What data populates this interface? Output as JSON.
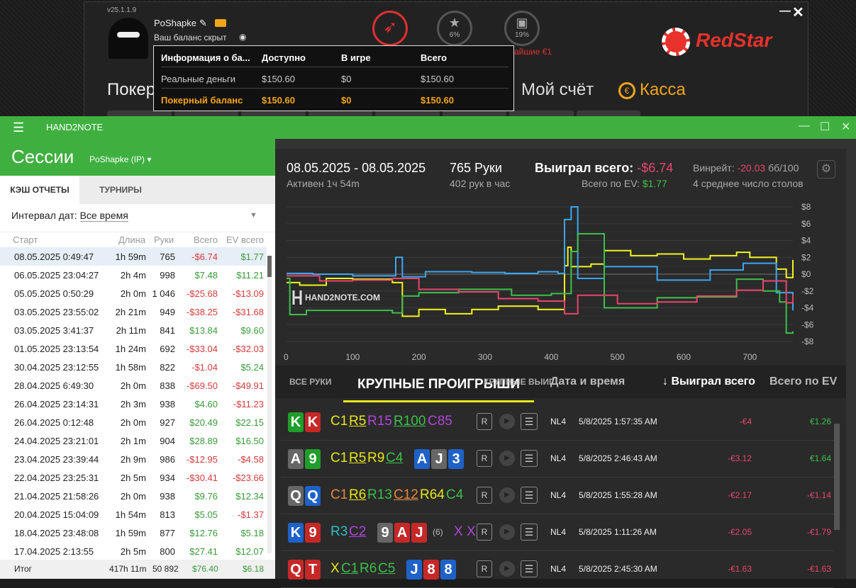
{
  "redstar": {
    "version": "v25.1.1.9",
    "username": "PoShapke",
    "balance_hidden": "Ваш баланс скрыт",
    "rocket_label": "",
    "star_pct": "6%",
    "gift_pct": "19%",
    "bonus_text": "айшие €1",
    "logo_text": "RedStar",
    "nav_poker": "Покер",
    "nav_account": "Мой счёт",
    "nav_cashier": "Касса"
  },
  "balance_table": {
    "headers": [
      "Информация о ба...",
      "Доступно",
      "В игре",
      "Всего"
    ],
    "rows": [
      [
        "Реальные деньги",
        "$150.60",
        "$0",
        "$150.60"
      ],
      [
        "Покерный баланс",
        "$150.60",
        "$0",
        "$150.60"
      ]
    ]
  },
  "h2n": {
    "app_title": "HAND2NOTE",
    "page_title": "Сессии",
    "user_select": "PoShapke (IP)",
    "tab_cash": "КЭШ ОТЧЕТЫ",
    "tab_tournaments": "ТУРНИРЫ",
    "interval_label": "Интервал дат:",
    "interval_value": "Все время",
    "columns": [
      "Старт",
      "Длина",
      "Руки",
      "Всего",
      "EV всего"
    ],
    "sessions": [
      [
        "08.05.2025 0:49:47",
        "1h 59m",
        "765",
        "-$6.74",
        "$1.77"
      ],
      [
        "06.05.2025 23:04:27",
        "2h 4m",
        "998",
        "$7.48",
        "$11.21"
      ],
      [
        "05.05.2025 0:50:29",
        "2h 0m",
        "1 046",
        "-$25.68",
        "-$13.09"
      ],
      [
        "03.05.2025 23:55:02",
        "2h 21m",
        "949",
        "-$38.25",
        "-$31.68"
      ],
      [
        "03.05.2025 3:41:37",
        "2h 11m",
        "841",
        "$13.84",
        "$9.60"
      ],
      [
        "01.05.2025 23:13:54",
        "1h 24m",
        "692",
        "-$33.04",
        "-$32.03"
      ],
      [
        "30.04.2025 23:12:55",
        "1h 58m",
        "822",
        "-$1.04",
        "$5.24"
      ],
      [
        "28.04.2025 6:49:30",
        "2h 0m",
        "838",
        "-$69.50",
        "-$49.91"
      ],
      [
        "26.04.2025 23:14:31",
        "2h 3m",
        "938",
        "$4.60",
        "-$11.23"
      ],
      [
        "26.04.2025 0:12:48",
        "2h 0m",
        "927",
        "$20.49",
        "$22.15"
      ],
      [
        "24.04.2025 23:21:01",
        "2h 1m",
        "904",
        "$28.89",
        "$16.50"
      ],
      [
        "23.04.2025 23:39:44",
        "2h 9m",
        "986",
        "-$12.95",
        "-$4.58"
      ],
      [
        "22.04.2025 23:25:31",
        "2h 5m",
        "934",
        "-$30.41",
        "-$23.66"
      ],
      [
        "21.04.2025 21:58:26",
        "2h 0m",
        "938",
        "$9.76",
        "$12.34"
      ],
      [
        "20.04.2025 15:04:09",
        "1h 54m",
        "813",
        "$5.05",
        "-$1.37"
      ],
      [
        "18.04.2025 23:48:08",
        "1h 59m",
        "877",
        "$12.76",
        "$5.18"
      ],
      [
        "17.04.2025 2:13:55",
        "2h 5m",
        "800",
        "$27.41",
        "$12.07"
      ]
    ],
    "footer": [
      "Итог",
      "417h 11m",
      "50 892",
      "$76.40",
      "$6.18"
    ]
  },
  "session": {
    "date_range": "08.05.2025 - 08.05.2025",
    "active": "Активен 1ч 54m",
    "hands": "765 Руки",
    "hands_per_hour": "402 рук в час",
    "won_label": "Выиграл всего:",
    "won_value": "-$6.74",
    "ev_label": "Всего по EV:",
    "ev_value": "$1.77",
    "winrate_label": "Винрейт:",
    "winrate_value": "-20.03",
    "winrate_unit": "бб/100",
    "tables": "4 среднее число столов",
    "watermark": "HAND2NOTE.COM"
  },
  "chart_data": {
    "type": "line",
    "x_ticks": [
      "0",
      "100",
      "200",
      "300",
      "400",
      "500",
      "600",
      "700"
    ],
    "y_ticks": [
      "$8",
      "$6",
      "$4",
      "$2",
      "$0",
      "-$2",
      "-$4",
      "-$6",
      "-$8"
    ],
    "ylim": [
      -8,
      8
    ],
    "xlim": [
      0,
      765
    ],
    "grid": true,
    "series": [
      {
        "color": "#f2f21e",
        "x": [
          0,
          20,
          60,
          100,
          160,
          175,
          200,
          240,
          280,
          320,
          380,
          410,
          420,
          425,
          430,
          460,
          480,
          520,
          560,
          600,
          640,
          680,
          700,
          740,
          755,
          765
        ],
        "values": [
          -1,
          -1.3,
          -0.5,
          -0.6,
          -1,
          -5,
          -4.2,
          -4.7,
          -4.2,
          -3.8,
          -4.2,
          -4.2,
          1,
          3.2,
          0.9,
          1.2,
          2.8,
          2.2,
          2.4,
          1.8,
          2.2,
          2.6,
          2,
          0.6,
          -0.4,
          1.7
        ]
      },
      {
        "color": "#3aa7f2",
        "x": [
          0,
          40,
          100,
          160,
          165,
          175,
          210,
          280,
          330,
          380,
          410,
          420,
          430,
          440,
          480,
          560,
          640,
          690,
          740,
          765
        ],
        "values": [
          0.1,
          0,
          -0.2,
          -0.2,
          2,
          -0.3,
          0.3,
          0.2,
          0.1,
          0.3,
          0.1,
          6.5,
          8,
          -0.5,
          0.9,
          -0.7,
          0.5,
          1.3,
          -2.2,
          -4.3
        ]
      },
      {
        "color": "#3cc04a",
        "x": [
          0,
          5,
          30,
          100,
          160,
          175,
          200,
          260,
          340,
          400,
          420,
          430,
          440,
          480,
          560,
          620,
          680,
          720,
          745,
          755,
          765
        ],
        "values": [
          -0.5,
          -4.8,
          -4.3,
          -4.3,
          -4.6,
          -2.6,
          -2.2,
          -1.8,
          -2.5,
          -2.3,
          -2.3,
          2.7,
          4.8,
          -4,
          -2.8,
          -2.7,
          -0.6,
          -2,
          -3.3,
          -7,
          -6.8
        ]
      },
      {
        "color": "#e8456b",
        "x": [
          0,
          50,
          100,
          160,
          200,
          260,
          320,
          380,
          420,
          440,
          500,
          560,
          620,
          680,
          720,
          755,
          765
        ],
        "values": [
          -0.2,
          -0.8,
          -0.7,
          -0.5,
          -1.8,
          -2.1,
          -2.9,
          -3.2,
          -4.7,
          -2.5,
          -3.5,
          -3.3,
          -2.6,
          -1.9,
          -0.8,
          -3.4,
          -2.4
        ]
      }
    ]
  },
  "hands_tabs": {
    "all": "ВСЕ РУКИ",
    "losses": "КРУПНЫЕ ПРОИГРЫШИ",
    "wins": "КРУПНЫЕ ВЫИГ",
    "col_date": "Дата и время",
    "col_won": "↓ Выиграл всего",
    "col_ev": "Всего по EV"
  },
  "hands": [
    {
      "cards": [
        [
          "K",
          "#1f9e2b"
        ],
        [
          "K",
          "#c62828"
        ]
      ],
      "actions": [
        [
          "C1",
          "#e6e619"
        ],
        [
          "R5",
          "#e6e619"
        ],
        [
          "R15",
          "#b044d9"
        ],
        [
          "R100",
          "#3cc04a"
        ],
        [
          "C85",
          "#b044d9"
        ]
      ],
      "limit": "NL4",
      "date": "5/8/2025 1:57:35 AM",
      "won": "-€4",
      "ev": "€1.26"
    },
    {
      "cards": [
        [
          "A",
          "#666"
        ],
        [
          "9",
          "#1f9e2b"
        ]
      ],
      "actions": [
        [
          "C1",
          "#e6e619"
        ],
        [
          "R5",
          "#e6e619"
        ],
        [
          "R9",
          "#e6e619"
        ],
        [
          "C4",
          "#3cc04a"
        ]
      ],
      "board": [
        [
          "A",
          "#1e62c8"
        ],
        [
          "J",
          "#666"
        ],
        [
          "3",
          "#1e62c8"
        ]
      ],
      "limit": "NL4",
      "date": "5/8/2025 2:46:43 AM",
      "won": "-€3.12",
      "ev": "€1.64"
    },
    {
      "cards": [
        [
          "Q",
          "#666"
        ],
        [
          "Q",
          "#1e62c8"
        ]
      ],
      "actions": [
        [
          "C1",
          "#e8863c"
        ],
        [
          "R6",
          "#e6e619"
        ],
        [
          "R13",
          "#3cc04a"
        ],
        [
          "C12",
          "#e8863c"
        ],
        [
          "R64",
          "#e6e619"
        ],
        [
          "C4",
          "#3cc04a"
        ]
      ],
      "limit": "NL4",
      "date": "5/8/2025 1:55:28 AM",
      "won": "-€2.17",
      "ev": "-€1.14"
    },
    {
      "cards": [
        [
          "K",
          "#1e62c8"
        ],
        [
          "9",
          "#c62828"
        ]
      ],
      "actions": [
        [
          "R3",
          "#2fbfbf"
        ],
        [
          "C2",
          "#b044d9"
        ]
      ],
      "board": [
        [
          "9",
          "#666"
        ],
        [
          "A",
          "#c62828"
        ],
        [
          "J",
          "#c62828"
        ]
      ],
      "extra": "(6)",
      "extra2": "X X",
      "limit": "NL4",
      "date": "5/8/2025 1:11:26 AM",
      "won": "-€2.05",
      "ev": "-€1.79"
    },
    {
      "cards": [
        [
          "Q",
          "#c62828"
        ],
        [
          "T",
          "#c62828"
        ]
      ],
      "actions": [
        [
          "X",
          "#e6e619"
        ],
        [
          "C1",
          "#3cc04a"
        ],
        [
          "R6",
          "#3cc04a"
        ],
        [
          "C5",
          "#3cc04a"
        ]
      ],
      "board": [
        [
          "J",
          "#1e62c8"
        ],
        [
          "8",
          "#c62828"
        ],
        [
          "8",
          "#1e62c8"
        ]
      ],
      "limit": "NL4",
      "date": "5/8/2025 2:45:30 AM",
      "won": "-€1.63",
      "ev": "-€1.63"
    }
  ]
}
